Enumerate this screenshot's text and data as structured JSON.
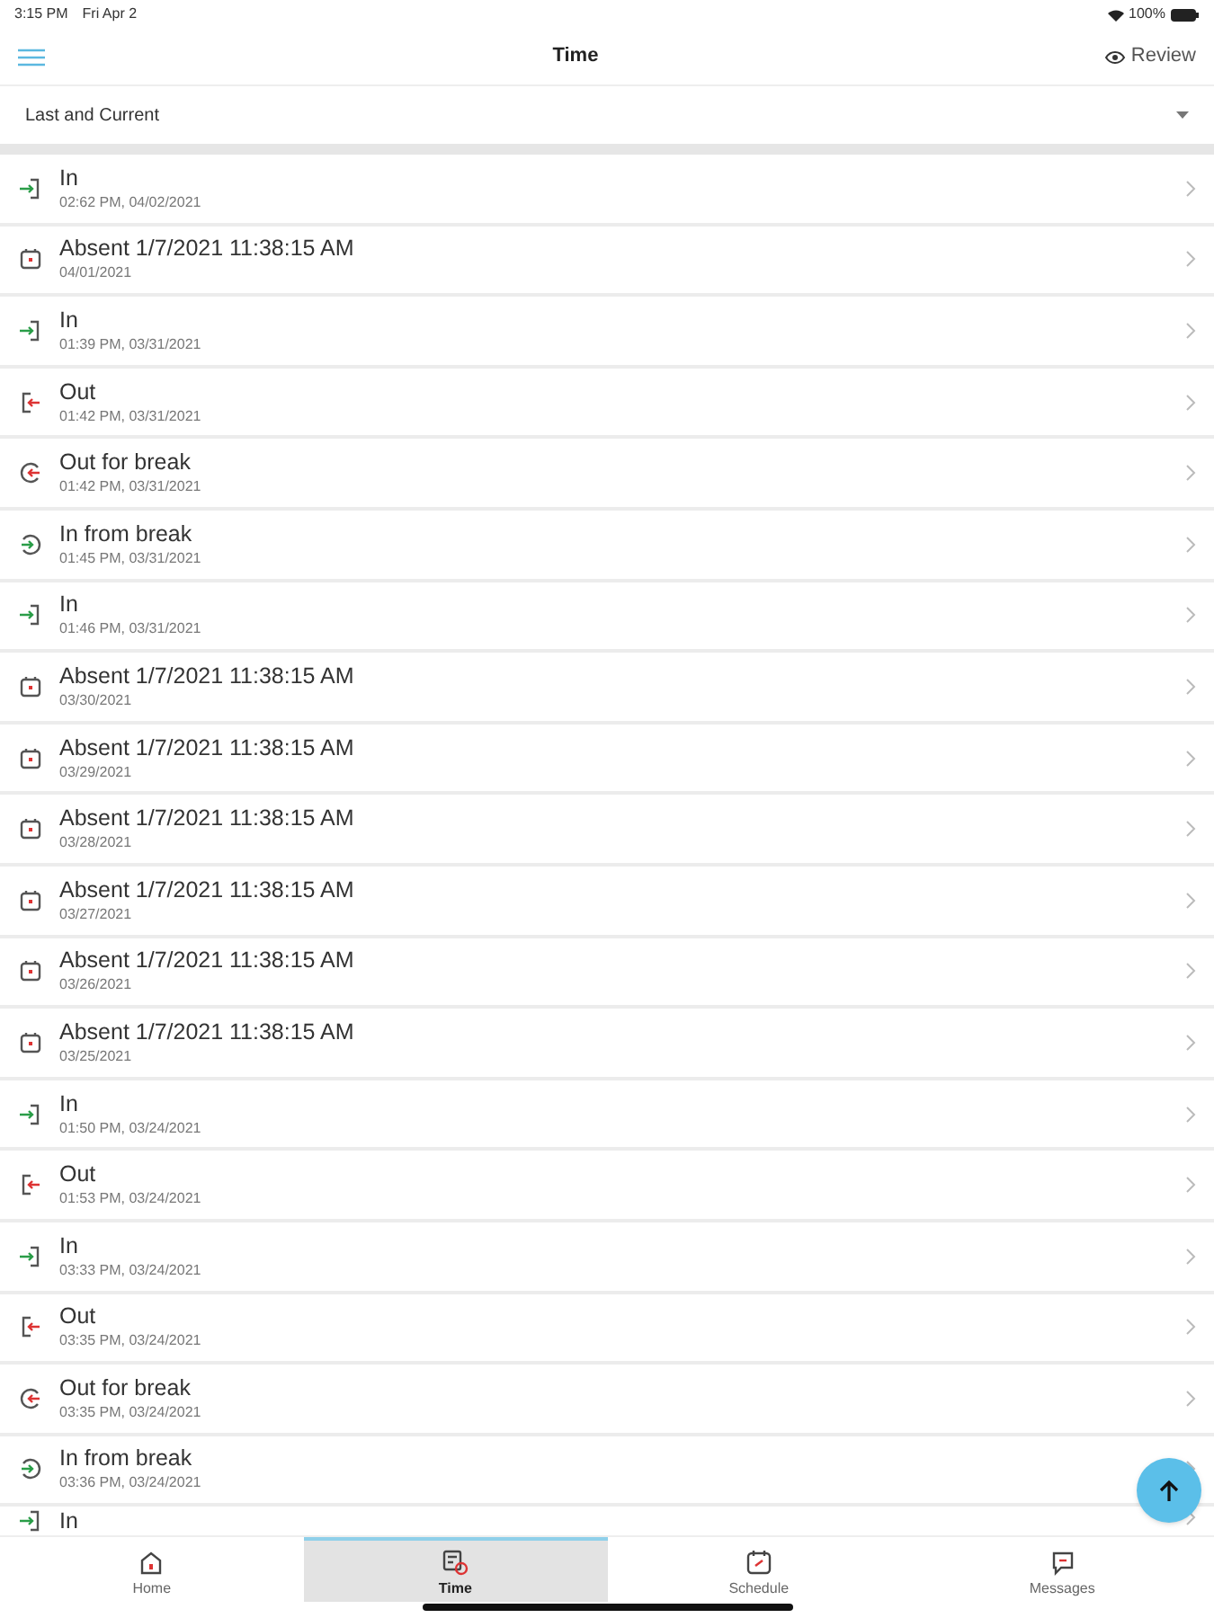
{
  "status_bar": {
    "time": "3:15 PM",
    "date": "Fri Apr 2",
    "battery": "100%"
  },
  "header": {
    "title": "Time",
    "action": "Review"
  },
  "filter": {
    "value": "Last and Current"
  },
  "entries": [
    {
      "kind": "in",
      "title": "In",
      "subtitle": "02:62 PM, 04/02/2021"
    },
    {
      "kind": "absent",
      "title": "Absent 1/7/2021 11:38:15 AM",
      "subtitle": "04/01/2021"
    },
    {
      "kind": "in",
      "title": "In",
      "subtitle": "01:39 PM, 03/31/2021"
    },
    {
      "kind": "out",
      "title": "Out",
      "subtitle": "01:42 PM, 03/31/2021"
    },
    {
      "kind": "out_break",
      "title": "Out for break",
      "subtitle": "01:42 PM, 03/31/2021"
    },
    {
      "kind": "in_break",
      "title": "In from break",
      "subtitle": "01:45 PM, 03/31/2021"
    },
    {
      "kind": "in",
      "title": "In",
      "subtitle": "01:46 PM, 03/31/2021"
    },
    {
      "kind": "absent",
      "title": "Absent 1/7/2021 11:38:15 AM",
      "subtitle": "03/30/2021"
    },
    {
      "kind": "absent",
      "title": "Absent 1/7/2021 11:38:15 AM",
      "subtitle": "03/29/2021"
    },
    {
      "kind": "absent",
      "title": "Absent 1/7/2021 11:38:15 AM",
      "subtitle": "03/28/2021"
    },
    {
      "kind": "absent",
      "title": "Absent 1/7/2021 11:38:15 AM",
      "subtitle": "03/27/2021"
    },
    {
      "kind": "absent",
      "title": "Absent 1/7/2021 11:38:15 AM",
      "subtitle": "03/26/2021"
    },
    {
      "kind": "absent",
      "title": "Absent 1/7/2021 11:38:15 AM",
      "subtitle": "03/25/2021"
    },
    {
      "kind": "in",
      "title": "In",
      "subtitle": "01:50 PM, 03/24/2021"
    },
    {
      "kind": "out",
      "title": "Out",
      "subtitle": "01:53 PM, 03/24/2021"
    },
    {
      "kind": "in",
      "title": "In",
      "subtitle": "03:33 PM, 03/24/2021"
    },
    {
      "kind": "out",
      "title": "Out",
      "subtitle": "03:35 PM, 03/24/2021"
    },
    {
      "kind": "out_break",
      "title": "Out for break",
      "subtitle": "03:35 PM, 03/24/2021"
    },
    {
      "kind": "in_break",
      "title": "In from break",
      "subtitle": "03:36 PM, 03/24/2021"
    },
    {
      "kind": "in",
      "title": "In"
    }
  ],
  "tabs": [
    {
      "kind": "home",
      "label": "Home",
      "selected": false
    },
    {
      "kind": "time",
      "label": "Time",
      "selected": true
    },
    {
      "kind": "schedule",
      "label": "Schedule",
      "selected": false
    },
    {
      "kind": "messages",
      "label": "Messages",
      "selected": false
    }
  ]
}
